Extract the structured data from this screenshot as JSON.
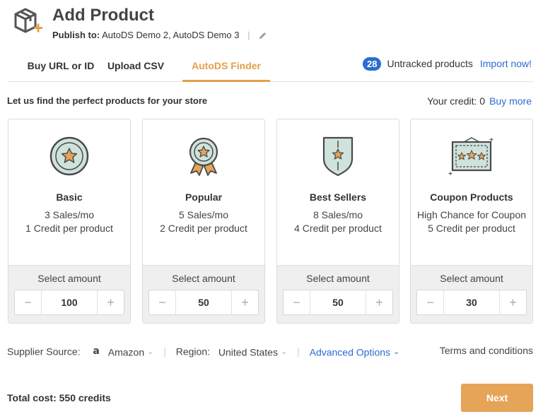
{
  "header": {
    "title": "Add Product",
    "publish_label": "Publish to:",
    "publish_targets": "AutoDS Demo 2, AutoDS Demo 3"
  },
  "tabs": [
    {
      "label": "Buy URL or ID",
      "active": false
    },
    {
      "label": "Upload CSV",
      "active": false
    },
    {
      "label": "AutoDS Finder",
      "active": true
    }
  ],
  "tracking": {
    "count": "28",
    "label": "Untracked products",
    "import_link": "Import now!"
  },
  "finder": {
    "subheading": "Let us find the perfect products for your store",
    "credit_label": "Your credit: 0",
    "buy_more": "Buy more"
  },
  "cards": [
    {
      "name": "Basic",
      "line1": "3 Sales/mo",
      "line2": "1 Credit per product",
      "select_label": "Select amount",
      "amount": "100",
      "icon": "star-badge-icon"
    },
    {
      "name": "Popular",
      "line1": "5 Sales/mo",
      "line2": "2 Credit per product",
      "select_label": "Select amount",
      "amount": "50",
      "icon": "ribbon-medal-icon"
    },
    {
      "name": "Best Sellers",
      "line1": "8 Sales/mo",
      "line2": "4 Credit per product",
      "select_label": "Select amount",
      "amount": "50",
      "icon": "shield-star-icon"
    },
    {
      "name": "Coupon Products",
      "line1": "High Chance for Coupon",
      "line2": "5 Credit per product",
      "select_label": "Select amount",
      "amount": "30",
      "icon": "coupon-stars-icon"
    }
  ],
  "stepper": {
    "minus": "−",
    "plus": "+"
  },
  "options": {
    "supplier_label": "Supplier Source:",
    "supplier_value": "Amazon",
    "region_label": "Region:",
    "region_value": "United States",
    "advanced": "Advanced Options",
    "terms": "Terms and conditions"
  },
  "footer": {
    "total": "Total cost: 550 credits",
    "next": "Next"
  },
  "colors": {
    "accent": "#e59f4c",
    "link": "#2b6cd0",
    "icon_fill": "#cfe3dc",
    "icon_stroke": "#4a4a4a"
  }
}
